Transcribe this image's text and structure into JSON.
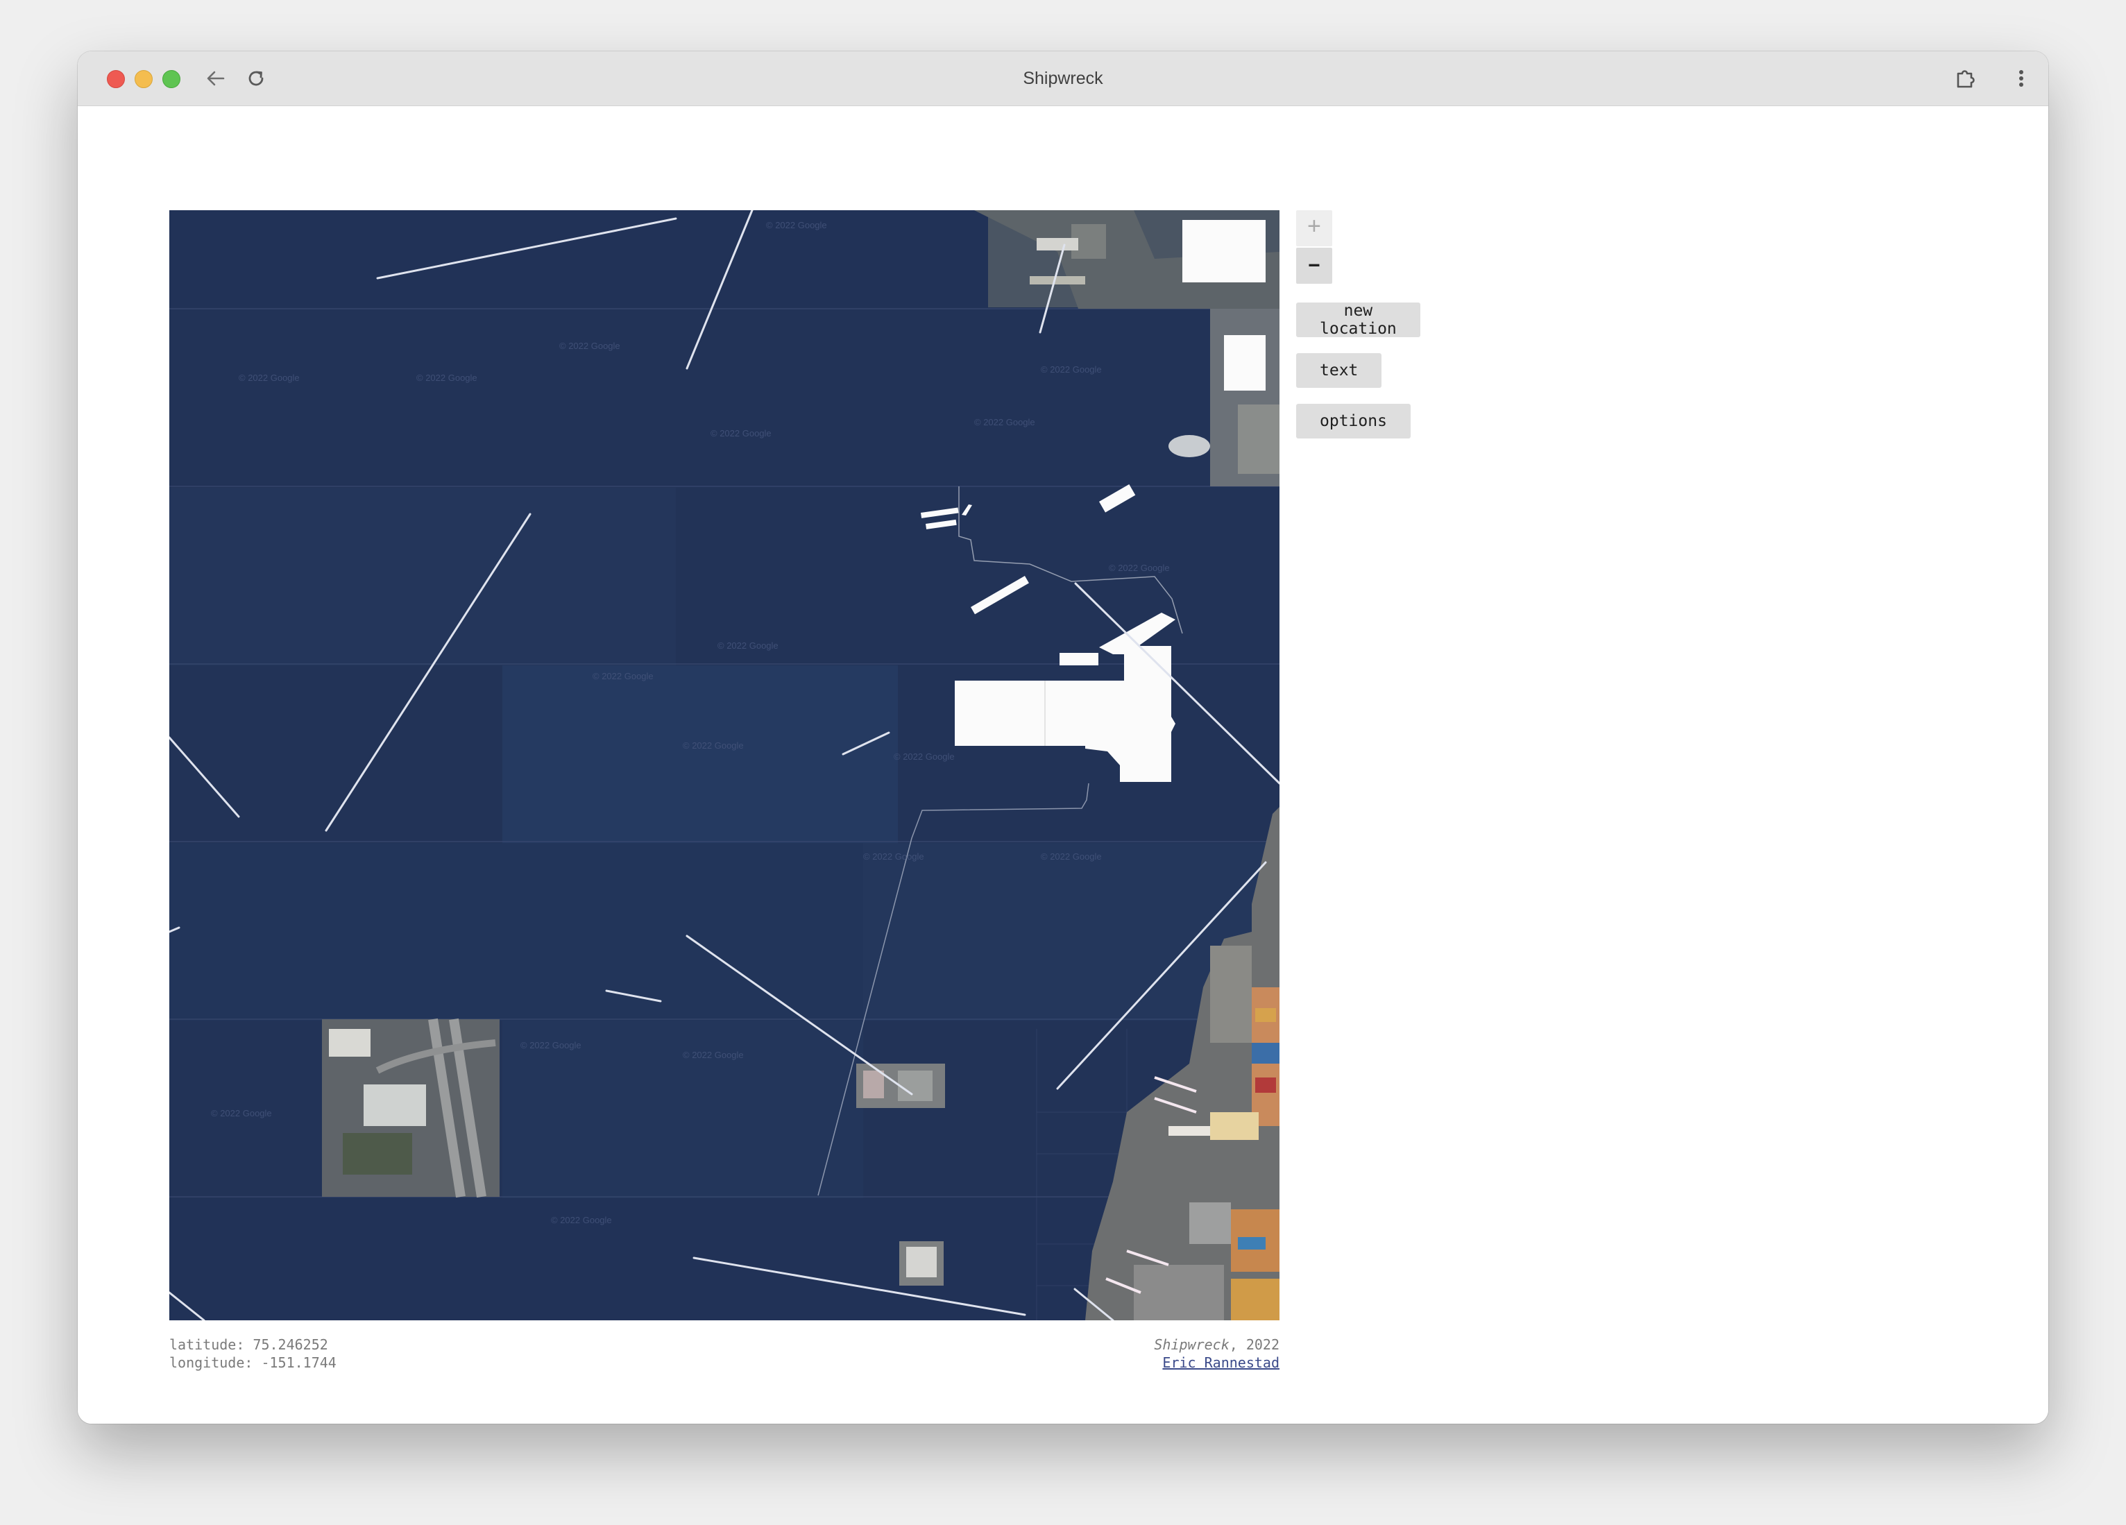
{
  "window": {
    "title": "Shipwreck"
  },
  "toolbar": {
    "back_icon": "back-arrow-icon",
    "reload_icon": "reload-icon",
    "extension_icon": "puzzle-extension-icon",
    "menu_icon": "vertical-dots-menu-icon"
  },
  "map": {
    "water_color": "#223357",
    "land_color": "#fbfbfb",
    "watermark": "© 2022 Google"
  },
  "controls": {
    "zoom_in_label": "+",
    "zoom_out_label": "–",
    "new_location_label": "new location",
    "text_label": "text",
    "options_label": "options"
  },
  "coords": {
    "latitude_label": "latitude:",
    "latitude_value": "75.246252",
    "longitude_label": "longitude:",
    "longitude_value": "-151.1744"
  },
  "credit": {
    "work_title": "Shipwreck",
    "year_suffix": ", 2022",
    "author": "Eric Rannestad"
  }
}
